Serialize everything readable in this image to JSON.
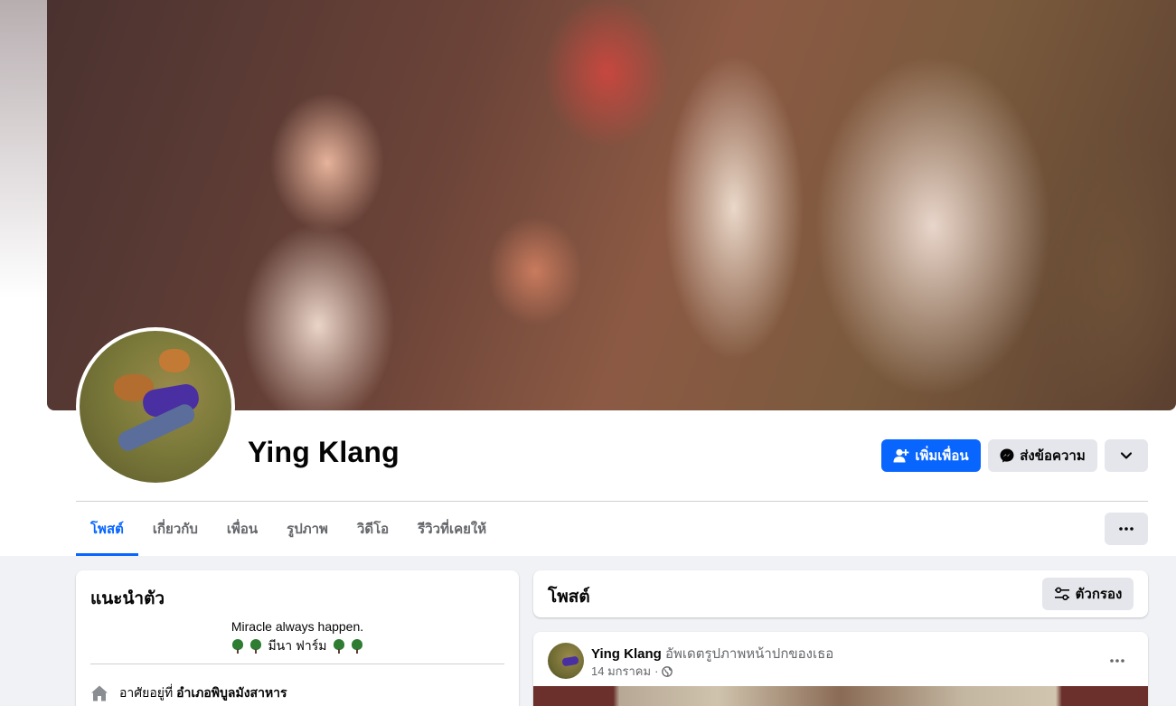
{
  "profile": {
    "name": "Ying Klang"
  },
  "actions": {
    "add_friend": "เพิ่มเพื่อน",
    "message": "ส่งข้อความ"
  },
  "tabs": [
    {
      "label": "โพสต์",
      "active": true
    },
    {
      "label": "เกี่ยวกับ",
      "active": false
    },
    {
      "label": "เพื่อน",
      "active": false
    },
    {
      "label": "รูปภาพ",
      "active": false
    },
    {
      "label": "วิดีโอ",
      "active": false
    },
    {
      "label": "รีวิวที่เคยให้",
      "active": false
    }
  ],
  "intro": {
    "title": "แนะนำตัว",
    "bio_line1": "Miracle always happen.",
    "bio_line2": "มีนา ฟาร์ม",
    "lives_prefix": "อาศัยอยู่ที่",
    "lives_place": "อำเภอพิบูลมังสาหาร"
  },
  "posts": {
    "title": "โพสต์",
    "filter_label": "ตัวกรอง"
  },
  "post": {
    "author": "Ying Klang",
    "action": "อัพเดตรูปภาพหน้าปกของเธอ",
    "date": "14 มกราคม",
    "separator": "·"
  },
  "colors": {
    "accent": "#0866ff",
    "button_gray": "#e4e6eb",
    "page_bg": "#f0f2f5",
    "secondary_text": "#65676b"
  },
  "icons": {
    "add_friend": "person-plus-icon",
    "message": "messenger-icon",
    "chevron": "chevron-down-icon",
    "more": "more-horizontal-icon",
    "filter": "filter-sliders-icon",
    "home": "home-icon",
    "globe": "globe-icon",
    "tree": "tree-icon"
  }
}
